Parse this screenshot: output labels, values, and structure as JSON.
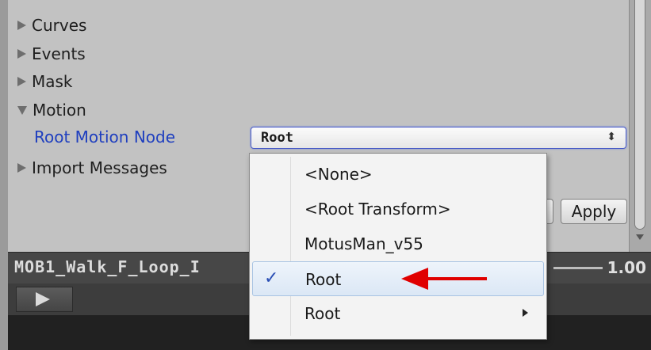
{
  "inspector": {
    "sections": {
      "curves": "Curves",
      "events": "Events",
      "mask": "Mask",
      "motion": "Motion",
      "import_messages": "Import Messages"
    },
    "root_motion_node": {
      "label": "Root Motion Node",
      "value": "Root",
      "arrows": "⬍"
    },
    "buttons": {
      "apply": "Apply"
    }
  },
  "dropdown": {
    "items": [
      {
        "label": "<None>",
        "selected": false,
        "submenu": false
      },
      {
        "label": "<Root Transform>",
        "selected": false,
        "submenu": false
      },
      {
        "label": "MotusMan_v55",
        "selected": false,
        "submenu": false
      },
      {
        "label": "Root",
        "selected": true,
        "submenu": false
      },
      {
        "label": "Root",
        "selected": false,
        "submenu": true
      }
    ],
    "check_mark": "✓"
  },
  "preview": {
    "clip_name": "MOB1_Walk_F_Loop_I",
    "speed": "1.00",
    "play_icon": "play-icon"
  },
  "colors": {
    "label_blue": "#1f3fbf",
    "annotation_red": "#e00000"
  }
}
